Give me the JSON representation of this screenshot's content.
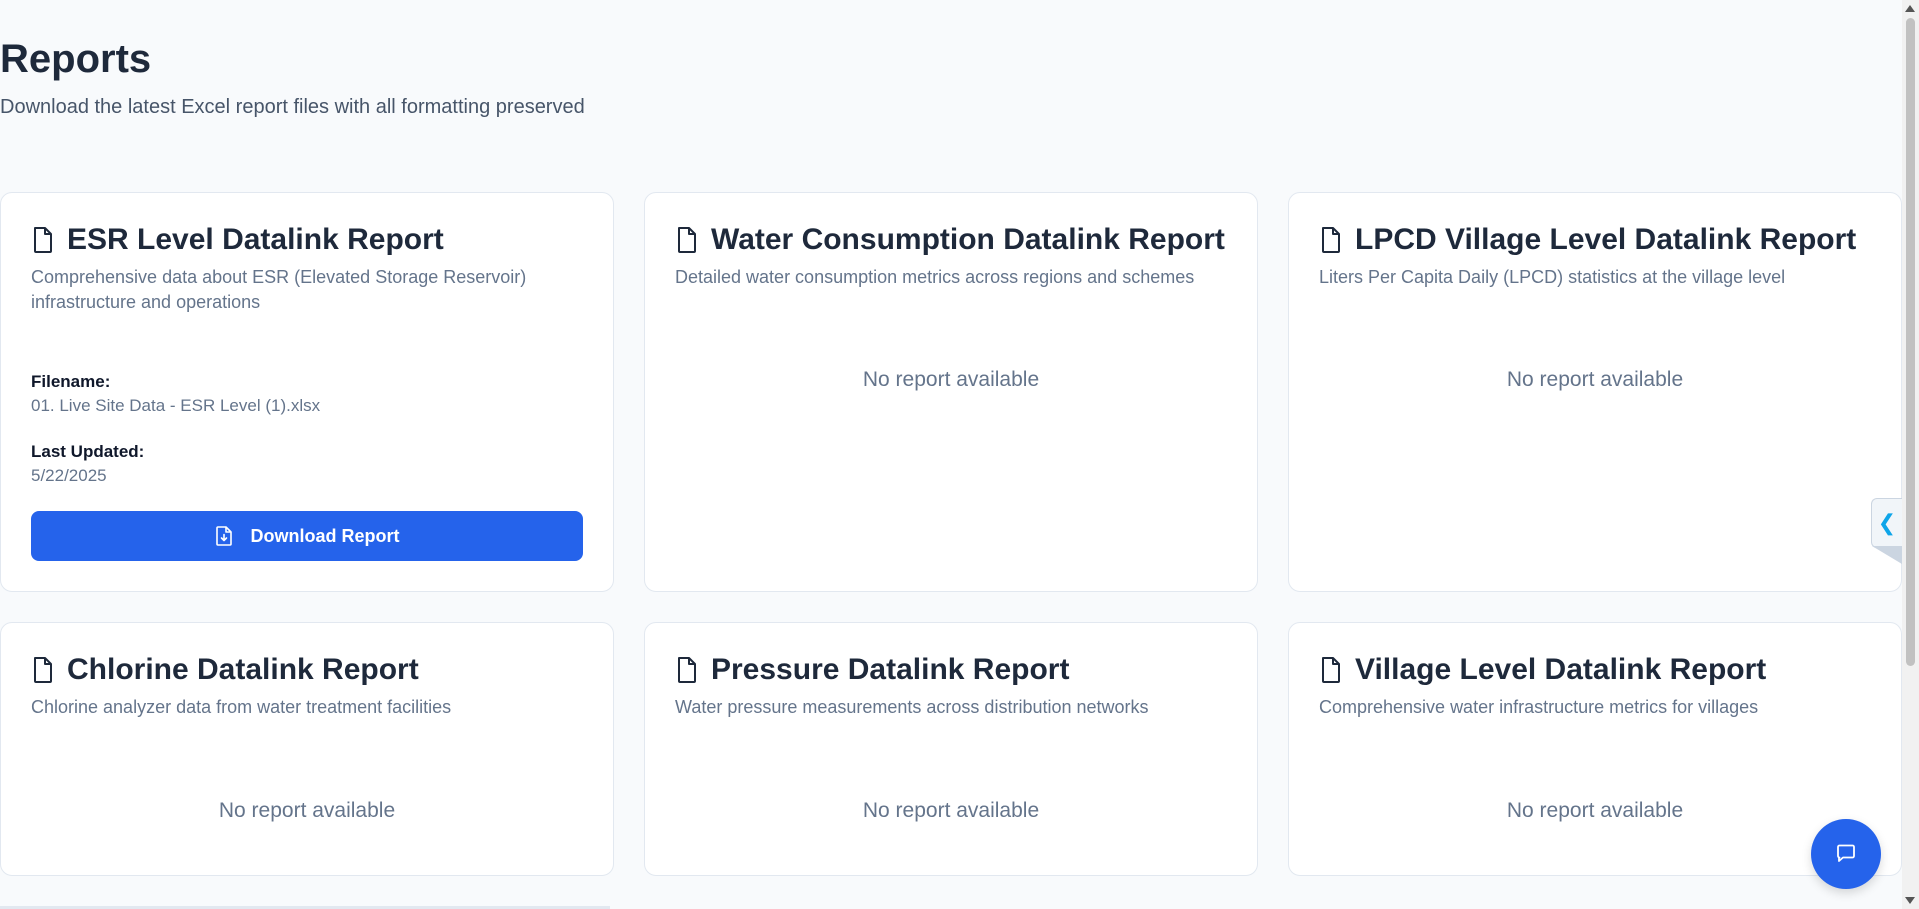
{
  "header": {
    "title": "Reports",
    "subtitle": "Download the latest Excel report files with all formatting preserved"
  },
  "reports": [
    {
      "title": "ESR Level Datalink Report",
      "description": "Comprehensive data about ESR (Elevated Storage Reservoir) infrastructure and operations",
      "filename_label": "Filename:",
      "filename": "01. Live Site Data - ESR Level (1).xlsx",
      "updated_label": "Last Updated:",
      "updated": "5/22/2025",
      "download_label": "Download Report",
      "icon": "file-icon"
    },
    {
      "title": "Water Consumption Datalink Report",
      "description": "Detailed water consumption metrics across regions and schemes",
      "empty": "No report available",
      "icon": "file-icon"
    },
    {
      "title": "LPCD Village Level Datalink Report",
      "description": "Liters Per Capita Daily (LPCD) statistics at the village level",
      "empty": "No report available",
      "icon": "file-icon"
    },
    {
      "title": "Chlorine Datalink Report",
      "description": "Chlorine analyzer data from water treatment facilities",
      "empty": "No report available",
      "icon": "file-icon"
    },
    {
      "title": "Pressure Datalink Report",
      "description": "Water pressure measurements across distribution networks",
      "empty": "No report available",
      "icon": "file-icon"
    },
    {
      "title": "Village Level Datalink Report",
      "description": "Comprehensive water infrastructure metrics for villages",
      "empty": "No report available",
      "icon": "file-icon"
    }
  ],
  "side_tab": {
    "icon": "chevron-left-icon",
    "glyph": "❮"
  },
  "chat_button": {
    "icon": "chat-icon"
  },
  "colors": {
    "accent": "#2563eb",
    "background": "#f8fafc",
    "card": "#ffffff",
    "muted_text": "#64748b"
  }
}
